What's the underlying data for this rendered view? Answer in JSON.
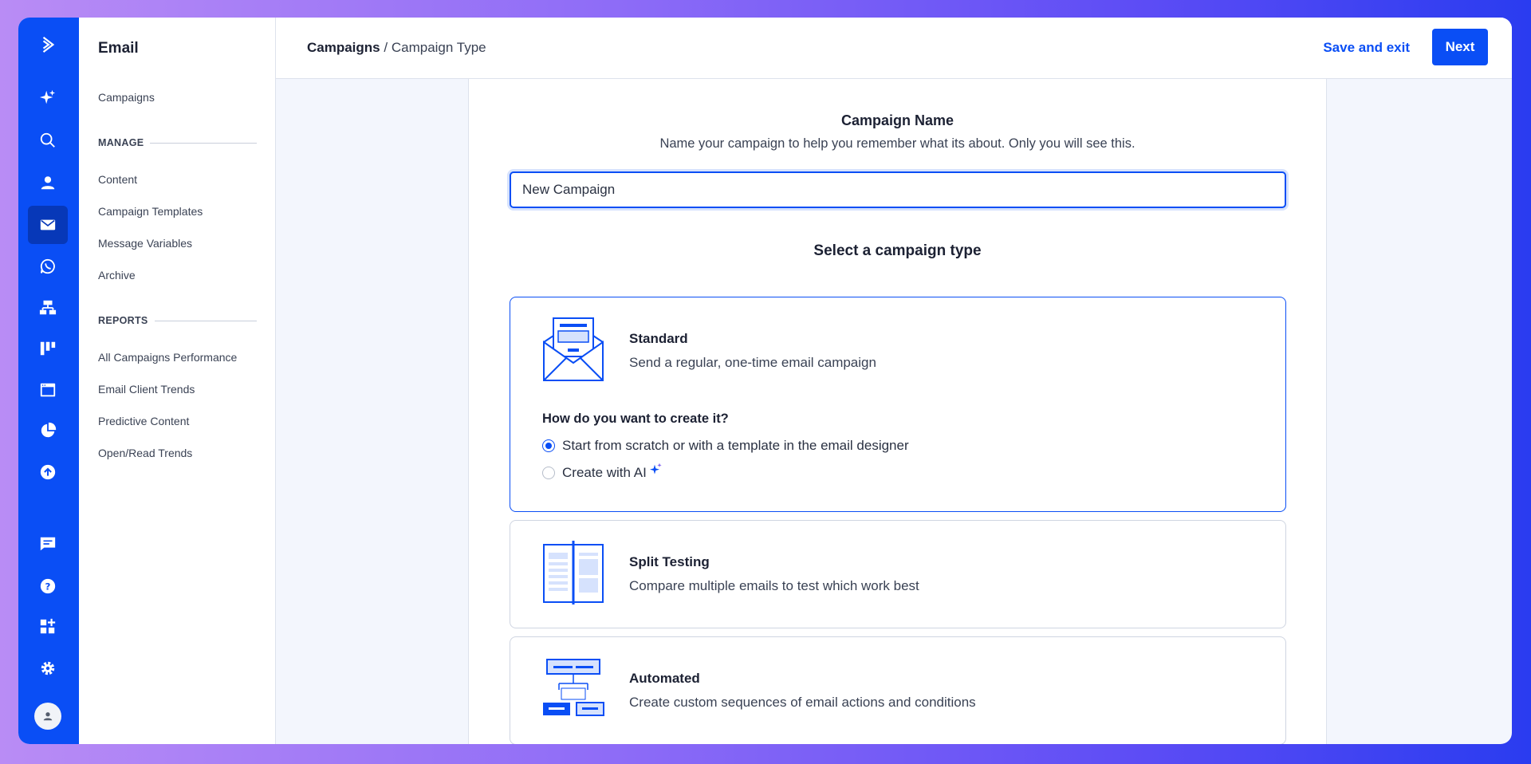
{
  "app": {
    "section_title": "Email",
    "breadcrumb": {
      "parent": "Campaigns",
      "separator": "/",
      "current": "Campaign Type"
    }
  },
  "rail": {
    "icons": [
      "logo-chevron-icon",
      "sparkle-icon",
      "search-icon",
      "contacts-icon",
      "email-icon",
      "whatsapp-icon",
      "automations-icon",
      "deals-icon",
      "website-icon",
      "reports-icon",
      "upload-icon",
      "conversations-icon",
      "help-icon",
      "apps-icon",
      "settings-icon",
      "user-avatar-icon"
    ],
    "active": "email-icon"
  },
  "sidebar": {
    "top_items": [
      "Campaigns"
    ],
    "manage_label": "MANAGE",
    "manage_items": [
      "Content",
      "Campaign Templates",
      "Message Variables",
      "Archive"
    ],
    "reports_label": "REPORTS",
    "reports_items": [
      "All Campaigns Performance",
      "Email Client Trends",
      "Predictive Content",
      "Open/Read Trends"
    ]
  },
  "toolbar": {
    "save_exit_label": "Save and exit",
    "next_label": "Next"
  },
  "form": {
    "name_title": "Campaign Name",
    "name_subtitle": "Name your campaign to help you remember what its about. Only you will see this.",
    "name_value": "New Campaign",
    "type_title": "Select a campaign type"
  },
  "cards": {
    "standard": {
      "title": "Standard",
      "desc": "Send a regular, one-time email campaign",
      "how_title": "How do you want to create it?",
      "options": [
        "Start from scratch or with a template in the email designer",
        "Create with AI"
      ],
      "selected_option": 0
    },
    "split": {
      "title": "Split Testing",
      "desc": "Compare multiple emails to test which work best"
    },
    "automated": {
      "title": "Automated",
      "desc": "Create custom sequences of email actions and conditions"
    }
  },
  "colors": {
    "brand": "#0a4ef5",
    "rail_active": "#0738b8",
    "illustration_fill": "#d6e2fd"
  }
}
